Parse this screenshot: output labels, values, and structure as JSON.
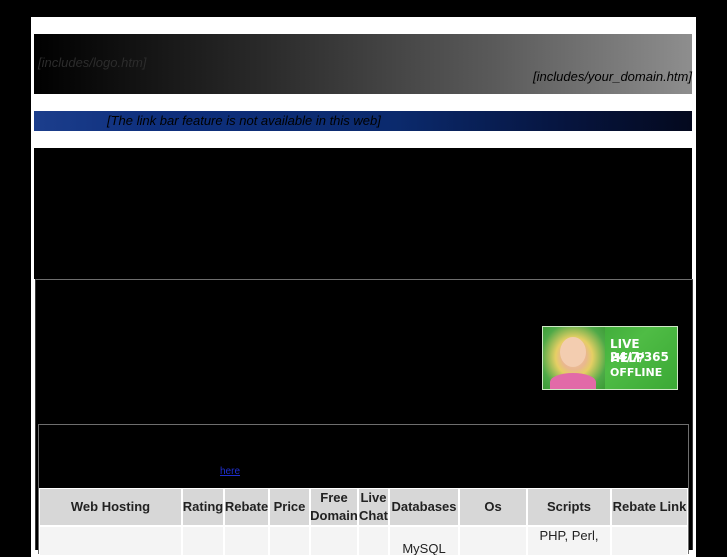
{
  "header": {
    "logo_include": "[includes/logo.htm]",
    "domain_include": "[includes/your_domain.htm]"
  },
  "link_bar": {
    "text": "[The link bar feature is not available in this web]"
  },
  "live_help": {
    "line1": "LIVE HELP",
    "line2": "24/7/365",
    "line3": "OFFLINE",
    "icon": "headset-agent-photo"
  },
  "intro": {
    "link_text": "here"
  },
  "table": {
    "headers": [
      "Web Hosting",
      "Rating",
      "Rebate",
      "Price",
      "Free Domain",
      "Live Chat",
      "Databases",
      "Os",
      "Scripts",
      "Rebate Link"
    ],
    "row_partial": {
      "databases": "MySQL",
      "scripts": "PHP, Perl,"
    }
  },
  "colors": {
    "page_background": "#000000",
    "frame": "#ffffff",
    "link_bar": "#0e2f7d",
    "table_header": "#d7d7d7",
    "live_help_green": "#4fbc45"
  }
}
